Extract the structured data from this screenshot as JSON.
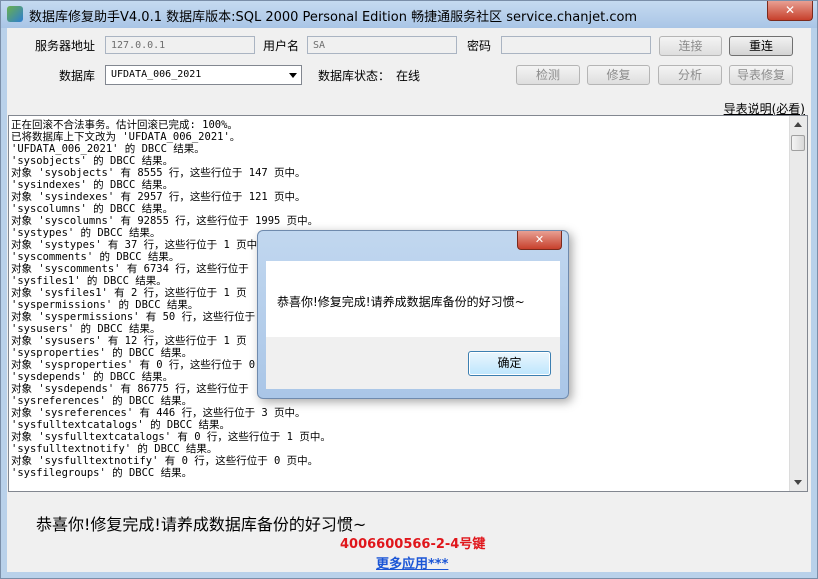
{
  "window": {
    "title": "数据库修复助手V4.0.1 数据库版本:SQL 2000 Personal Edition  畅捷通服务社区 service.chanjet.com",
    "close_label": "✕"
  },
  "form": {
    "server_label": "服务器地址",
    "server_value": "127.0.0.1",
    "user_label": "用户名",
    "user_value": "SA",
    "password_label": "密码",
    "password_value": "",
    "database_label": "数据库",
    "database_value": "UFDATA_006_2021",
    "status_label": "数据库状态：",
    "status_value": "在线"
  },
  "buttons": {
    "connect": "连接",
    "reconnect": "重连",
    "check": "检测",
    "repair": "修复",
    "analyze": "分析",
    "export_repair": "导表修复"
  },
  "help_link": "导表说明(必看)",
  "log_lines": [
    "正在回滚不合法事务。估计回滚已完成: 100%。",
    "已将数据库上下文改为 'UFDATA_006_2021'。",
    "'UFDATA_006_2021' 的 DBCC 结果。",
    "'sysobjects' 的 DBCC 结果。",
    "对象 'sysobjects' 有 8555 行，这些行位于 147 页中。",
    "'sysindexes' 的 DBCC 结果。",
    "对象 'sysindexes' 有 2957 行，这些行位于 121 页中。",
    "'syscolumns' 的 DBCC 结果。",
    "对象 'syscolumns' 有 92855 行，这些行位于 1995 页中。",
    "'systypes' 的 DBCC 结果。",
    "对象 'systypes' 有 37 行，这些行位于 1 页中。",
    "'syscomments' 的 DBCC 结果。",
    "对象 'syscomments' 有 6734 行，这些行位于",
    "'sysfiles1' 的 DBCC 结果。",
    "对象 'sysfiles1' 有 2 行，这些行位于 1 页",
    "'syspermissions' 的 DBCC 结果。",
    "对象 'syspermissions' 有 50 行，这些行位于",
    "'sysusers' 的 DBCC 结果。",
    "对象 'sysusers' 有 12 行，这些行位于 1 页",
    "'sysproperties' 的 DBCC 结果。",
    "对象 'sysproperties' 有 0 行，这些行位于 0",
    "'sysdepends' 的 DBCC 结果。",
    "对象 'sysdepends' 有 86775 行，这些行位于",
    "'sysreferences' 的 DBCC 结果。",
    "对象 'sysreferences' 有 446 行，这些行位于 3 页中。",
    "'sysfulltextcatalogs' 的 DBCC 结果。",
    "对象 'sysfulltextcatalogs' 有 0 行，这些行位于 1 页中。",
    "'sysfulltextnotify' 的 DBCC 结果。",
    "对象 'sysfulltextnotify' 有 0 行，这些行位于 0 页中。",
    "'sysfilegroups' 的 DBCC 结果。"
  ],
  "footer": {
    "congrats": "恭喜你!修复完成!请养成数据库备份的好习惯~",
    "phone": "4006600566-2-4号键",
    "more_link": "更多应用***"
  },
  "dialog": {
    "close_label": "✕",
    "message": "恭喜你!修复完成!请养成数据库备份的好习惯~",
    "ok_label": "确定"
  }
}
